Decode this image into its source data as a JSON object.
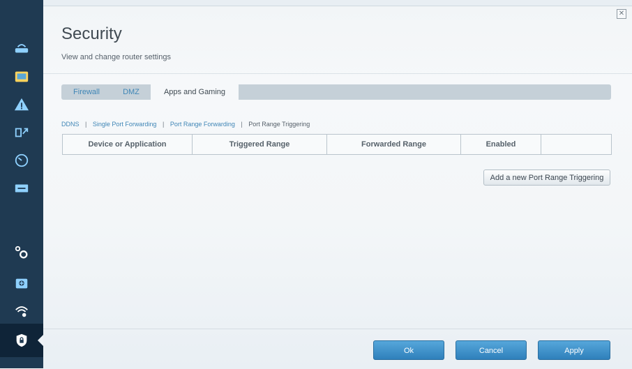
{
  "page": {
    "title": "Security",
    "subtitle": "View and change router settings"
  },
  "tabs": [
    "Firewall",
    "DMZ",
    "Apps and Gaming"
  ],
  "active_tab": "Apps and Gaming",
  "sub_links": [
    "DDNS",
    "Single Port Forwarding",
    "Port Range Forwarding",
    "Port Range Triggering"
  ],
  "current_sub_link": "Port Range Triggering",
  "table": {
    "columns": [
      "Device or Application",
      "Triggered Range",
      "Forwarded Range",
      "Enabled",
      ""
    ]
  },
  "add_button_label": "Add a new Port Range Triggering",
  "footer": {
    "ok": "Ok",
    "cancel": "Cancel",
    "apply": "Apply"
  },
  "sidebar_icons": [
    "router-icon",
    "devices-icon",
    "warning-icon",
    "media-icon",
    "speedometer-icon",
    "usb-icon",
    "settings-icon",
    "troubleshoot-icon",
    "wireless-icon",
    "security-lock-icon"
  ],
  "colors": {
    "sidebar": "#1f3a52",
    "accent": "#3f86b6",
    "button_blue": "#2f80bb"
  }
}
